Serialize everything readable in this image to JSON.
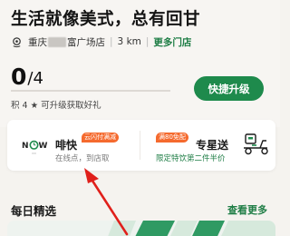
{
  "header": {
    "slogan": "生活就像美式，总有回甘",
    "store_city": "重庆",
    "store_name": "富广场店",
    "distance": "3 km",
    "more_stores_label": "更多门店"
  },
  "stars": {
    "count": "0",
    "total": "/4",
    "progress": 0,
    "upgrade_hint": "积 4 ★ 可升级获取好礼",
    "upgrade_button_label": "快捷升级"
  },
  "services": {
    "pickup": {
      "logo_text": "NOW",
      "title": "啡快",
      "subtitle": "在线点，到店取",
      "tag": "云闪付满减"
    },
    "delivery": {
      "title": "专星送",
      "subtitle": "限定特饮第二件半价",
      "tag": "满80免配"
    }
  },
  "daily": {
    "title": "每日精选",
    "see_more_label": "查看更多"
  },
  "colors": {
    "accent": "#1e7d45",
    "button": "#1e8a4c",
    "tag": "#f56a2e",
    "annotation_arrow": "#e0201b"
  },
  "icons": {
    "location": "location-pin-icon",
    "delivery": "scooter-icon"
  }
}
